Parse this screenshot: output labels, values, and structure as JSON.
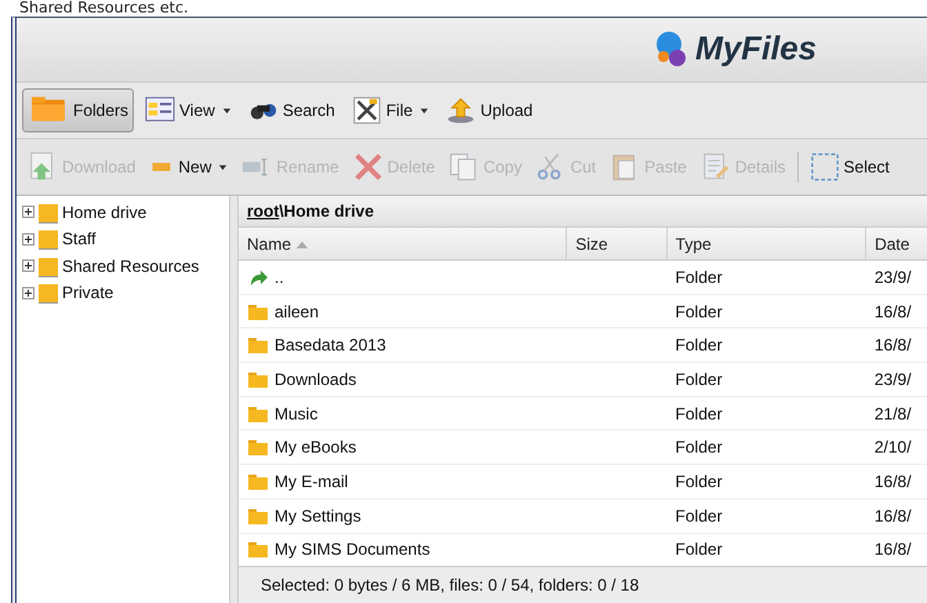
{
  "caption": "Shared Resources etc.",
  "app": {
    "title": "MyFiles"
  },
  "toolbar": [
    {
      "label": "Folders",
      "selected": true,
      "dropdown": false
    },
    {
      "label": "View",
      "selected": false,
      "dropdown": true
    },
    {
      "label": "Search",
      "selected": false,
      "dropdown": false
    },
    {
      "label": "File",
      "selected": false,
      "dropdown": true
    },
    {
      "label": "Upload",
      "selected": false,
      "dropdown": false
    }
  ],
  "actions": [
    {
      "label": "Download",
      "disabled": true,
      "dropdown": false
    },
    {
      "label": "New",
      "disabled": false,
      "dropdown": true
    },
    {
      "label": "Rename",
      "disabled": true,
      "dropdown": false
    },
    {
      "label": "Delete",
      "disabled": true,
      "dropdown": false
    },
    {
      "label": "Copy",
      "disabled": true,
      "dropdown": false
    },
    {
      "label": "Cut",
      "disabled": true,
      "dropdown": false
    },
    {
      "label": "Paste",
      "disabled": true,
      "dropdown": false
    },
    {
      "label": "Details",
      "disabled": true,
      "dropdown": false
    },
    {
      "label": "Select",
      "disabled": false,
      "dropdown": false
    }
  ],
  "tree": [
    {
      "label": "Home drive",
      "expanded": false
    },
    {
      "label": "Staff",
      "expanded": false
    },
    {
      "label": "Shared Resources",
      "expanded": false
    },
    {
      "label": "Private",
      "expanded": false
    }
  ],
  "path": {
    "root": "root",
    "rest": "\\Home drive"
  },
  "table": {
    "columns": [
      {
        "label": "Name",
        "sorted": true
      },
      {
        "label": "Size",
        "sorted": false
      },
      {
        "label": "Type",
        "sorted": false
      },
      {
        "label": "Date",
        "sorted": false
      }
    ],
    "rows": [
      {
        "kind": "up",
        "name": "..",
        "type": "Folder",
        "date": "23/9/"
      },
      {
        "kind": "folder",
        "name": "aileen",
        "type": "Folder",
        "date": "16/8/"
      },
      {
        "kind": "folder",
        "name": "Basedata 2013",
        "type": "Folder",
        "date": "16/8/"
      },
      {
        "kind": "folder",
        "name": "Downloads",
        "type": "Folder",
        "date": "23/9/"
      },
      {
        "kind": "folder",
        "name": "Music",
        "type": "Folder",
        "date": "21/8/"
      },
      {
        "kind": "folder",
        "name": "My eBooks",
        "type": "Folder",
        "date": "2/10/"
      },
      {
        "kind": "folder",
        "name": "My E-mail",
        "type": "Folder",
        "date": "16/8/"
      },
      {
        "kind": "folder",
        "name": "My Settings",
        "type": "Folder",
        "date": "16/8/"
      },
      {
        "kind": "folder",
        "name": "My SIMS Documents",
        "type": "Folder",
        "date": "16/8/"
      }
    ]
  },
  "status_bar": "Selected: 0 bytes / 6 MB, files: 0 / 54, folders: 0 / 18"
}
